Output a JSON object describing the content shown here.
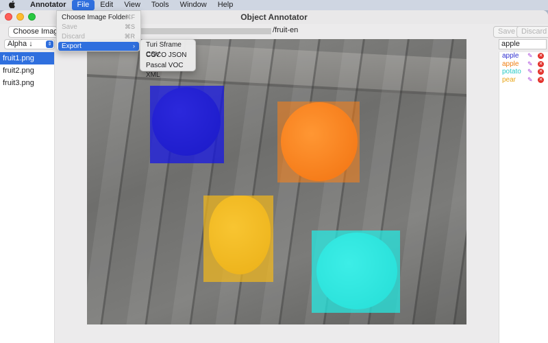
{
  "menubar": {
    "app_name": "Annotator",
    "menus": [
      "File",
      "Edit",
      "View",
      "Tools",
      "Window",
      "Help"
    ],
    "active_menu": "File"
  },
  "window": {
    "title": "Object Annotator"
  },
  "toolbar": {
    "choose_folder_label": "Choose Image Fo",
    "path_suffix": "/fruit-en",
    "save_label": "Save",
    "discard_label": "Discard"
  },
  "sidebar": {
    "sort_label": "Alpha ↓",
    "files": [
      {
        "name": "fruit1.png",
        "selected": true
      },
      {
        "name": "fruit2.png",
        "selected": false
      },
      {
        "name": "fruit3.png",
        "selected": false
      }
    ]
  },
  "labels_panel": {
    "input_value": "apple",
    "labels": [
      {
        "name": "apple",
        "color": "#2f2fd0"
      },
      {
        "name": "apple",
        "color": "#f07f13"
      },
      {
        "name": "potato",
        "color": "#27c9c6"
      },
      {
        "name": "pear",
        "color": "#e8a517"
      }
    ]
  },
  "file_menu": {
    "items": [
      {
        "label": "Choose Image Folder",
        "shortcut": "⌘F",
        "disabled": false
      },
      {
        "label": "Save",
        "shortcut": "⌘S",
        "disabled": true
      },
      {
        "label": "Discard",
        "shortcut": "⌘R",
        "disabled": true
      },
      {
        "label": "Export",
        "shortcut": "›",
        "disabled": false
      }
    ]
  },
  "export_submenu": {
    "items": [
      "Turi Sframe CSV",
      "COCO JSON",
      "Pascal VOC XML"
    ]
  },
  "annotation_colors": {
    "blue": "#1f1fe0",
    "orange": "#ff8a1a",
    "yellow": "#f5b81c",
    "cyan": "#26e8e0"
  }
}
